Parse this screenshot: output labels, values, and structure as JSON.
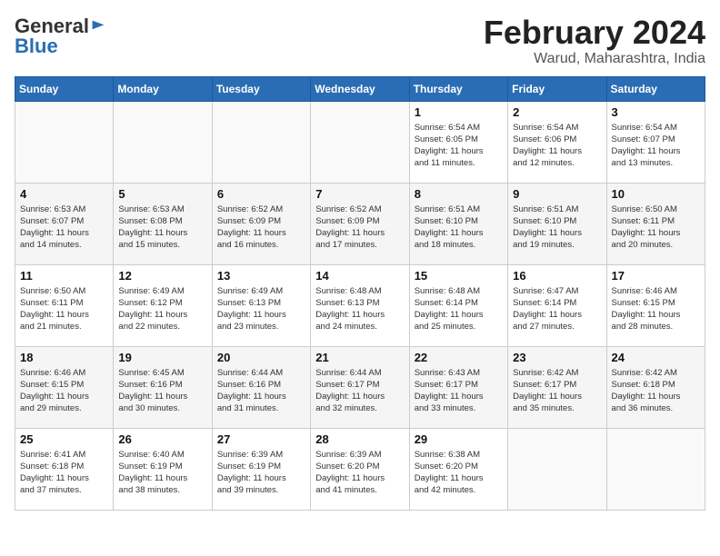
{
  "logo": {
    "general": "General",
    "blue": "Blue"
  },
  "header": {
    "month": "February 2024",
    "location": "Warud, Maharashtra, India"
  },
  "days_of_week": [
    "Sunday",
    "Monday",
    "Tuesday",
    "Wednesday",
    "Thursday",
    "Friday",
    "Saturday"
  ],
  "weeks": [
    [
      {
        "day": "",
        "info": ""
      },
      {
        "day": "",
        "info": ""
      },
      {
        "day": "",
        "info": ""
      },
      {
        "day": "",
        "info": ""
      },
      {
        "day": "1",
        "info": "Sunrise: 6:54 AM\nSunset: 6:05 PM\nDaylight: 11 hours\nand 11 minutes."
      },
      {
        "day": "2",
        "info": "Sunrise: 6:54 AM\nSunset: 6:06 PM\nDaylight: 11 hours\nand 12 minutes."
      },
      {
        "day": "3",
        "info": "Sunrise: 6:54 AM\nSunset: 6:07 PM\nDaylight: 11 hours\nand 13 minutes."
      }
    ],
    [
      {
        "day": "4",
        "info": "Sunrise: 6:53 AM\nSunset: 6:07 PM\nDaylight: 11 hours\nand 14 minutes."
      },
      {
        "day": "5",
        "info": "Sunrise: 6:53 AM\nSunset: 6:08 PM\nDaylight: 11 hours\nand 15 minutes."
      },
      {
        "day": "6",
        "info": "Sunrise: 6:52 AM\nSunset: 6:09 PM\nDaylight: 11 hours\nand 16 minutes."
      },
      {
        "day": "7",
        "info": "Sunrise: 6:52 AM\nSunset: 6:09 PM\nDaylight: 11 hours\nand 17 minutes."
      },
      {
        "day": "8",
        "info": "Sunrise: 6:51 AM\nSunset: 6:10 PM\nDaylight: 11 hours\nand 18 minutes."
      },
      {
        "day": "9",
        "info": "Sunrise: 6:51 AM\nSunset: 6:10 PM\nDaylight: 11 hours\nand 19 minutes."
      },
      {
        "day": "10",
        "info": "Sunrise: 6:50 AM\nSunset: 6:11 PM\nDaylight: 11 hours\nand 20 minutes."
      }
    ],
    [
      {
        "day": "11",
        "info": "Sunrise: 6:50 AM\nSunset: 6:11 PM\nDaylight: 11 hours\nand 21 minutes."
      },
      {
        "day": "12",
        "info": "Sunrise: 6:49 AM\nSunset: 6:12 PM\nDaylight: 11 hours\nand 22 minutes."
      },
      {
        "day": "13",
        "info": "Sunrise: 6:49 AM\nSunset: 6:13 PM\nDaylight: 11 hours\nand 23 minutes."
      },
      {
        "day": "14",
        "info": "Sunrise: 6:48 AM\nSunset: 6:13 PM\nDaylight: 11 hours\nand 24 minutes."
      },
      {
        "day": "15",
        "info": "Sunrise: 6:48 AM\nSunset: 6:14 PM\nDaylight: 11 hours\nand 25 minutes."
      },
      {
        "day": "16",
        "info": "Sunrise: 6:47 AM\nSunset: 6:14 PM\nDaylight: 11 hours\nand 27 minutes."
      },
      {
        "day": "17",
        "info": "Sunrise: 6:46 AM\nSunset: 6:15 PM\nDaylight: 11 hours\nand 28 minutes."
      }
    ],
    [
      {
        "day": "18",
        "info": "Sunrise: 6:46 AM\nSunset: 6:15 PM\nDaylight: 11 hours\nand 29 minutes."
      },
      {
        "day": "19",
        "info": "Sunrise: 6:45 AM\nSunset: 6:16 PM\nDaylight: 11 hours\nand 30 minutes."
      },
      {
        "day": "20",
        "info": "Sunrise: 6:44 AM\nSunset: 6:16 PM\nDaylight: 11 hours\nand 31 minutes."
      },
      {
        "day": "21",
        "info": "Sunrise: 6:44 AM\nSunset: 6:17 PM\nDaylight: 11 hours\nand 32 minutes."
      },
      {
        "day": "22",
        "info": "Sunrise: 6:43 AM\nSunset: 6:17 PM\nDaylight: 11 hours\nand 33 minutes."
      },
      {
        "day": "23",
        "info": "Sunrise: 6:42 AM\nSunset: 6:17 PM\nDaylight: 11 hours\nand 35 minutes."
      },
      {
        "day": "24",
        "info": "Sunrise: 6:42 AM\nSunset: 6:18 PM\nDaylight: 11 hours\nand 36 minutes."
      }
    ],
    [
      {
        "day": "25",
        "info": "Sunrise: 6:41 AM\nSunset: 6:18 PM\nDaylight: 11 hours\nand 37 minutes."
      },
      {
        "day": "26",
        "info": "Sunrise: 6:40 AM\nSunset: 6:19 PM\nDaylight: 11 hours\nand 38 minutes."
      },
      {
        "day": "27",
        "info": "Sunrise: 6:39 AM\nSunset: 6:19 PM\nDaylight: 11 hours\nand 39 minutes."
      },
      {
        "day": "28",
        "info": "Sunrise: 6:39 AM\nSunset: 6:20 PM\nDaylight: 11 hours\nand 41 minutes."
      },
      {
        "day": "29",
        "info": "Sunrise: 6:38 AM\nSunset: 6:20 PM\nDaylight: 11 hours\nand 42 minutes."
      },
      {
        "day": "",
        "info": ""
      },
      {
        "day": "",
        "info": ""
      }
    ]
  ]
}
